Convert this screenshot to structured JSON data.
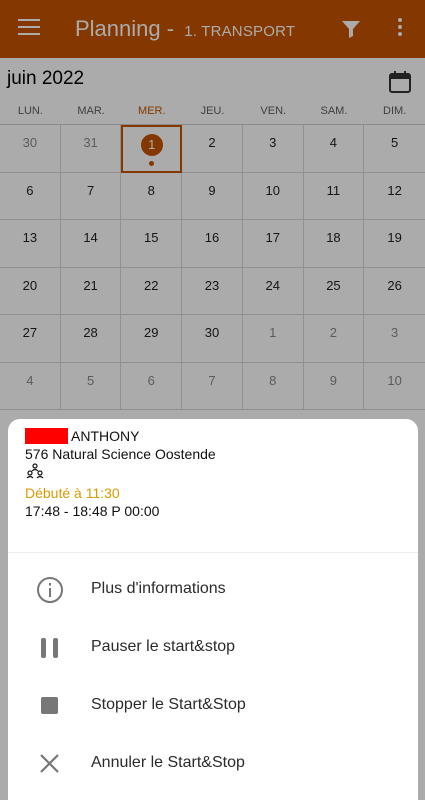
{
  "appbar": {
    "title": "Planning -",
    "subtitle": "1. TRANSPORT",
    "icons": [
      "menu-icon",
      "filter-icon",
      "more-vert-icon"
    ],
    "color": "#c65300"
  },
  "calendar": {
    "month_label": "juin 2022",
    "weekdays": [
      "LUN.",
      "MAR.",
      "MER.",
      "JEU.",
      "VEN.",
      "SAM.",
      "DIM."
    ],
    "today_weekday": "MER.",
    "weeks": [
      [
        "30",
        "31",
        "1",
        "2",
        "3",
        "4",
        "5"
      ],
      [
        "6",
        "7",
        "8",
        "9",
        "10",
        "11",
        "12"
      ],
      [
        "13",
        "14",
        "15",
        "16",
        "17",
        "18",
        "19"
      ],
      [
        "20",
        "21",
        "22",
        "23",
        "24",
        "25",
        "26"
      ],
      [
        "27",
        "28",
        "29",
        "30",
        "1",
        "2",
        "3"
      ],
      [
        "4",
        "5",
        "6",
        "7",
        "8",
        "9",
        "10"
      ]
    ],
    "selected_day": "1"
  },
  "sheet": {
    "name": "ANTHONY",
    "address": "576 Natural Science Oostende",
    "started": "Débuté à 11:30",
    "time_range": "17:48 - 18:48 P 00:00",
    "actions": [
      {
        "label": "Plus d'informations",
        "icon": "info-icon"
      },
      {
        "label": "Pauser le start&stop",
        "icon": "pause-icon"
      },
      {
        "label": "Stopper le Start&Stop",
        "icon": "stop-icon"
      },
      {
        "label": "Annuler le Start&Stop",
        "icon": "close-icon"
      }
    ]
  }
}
